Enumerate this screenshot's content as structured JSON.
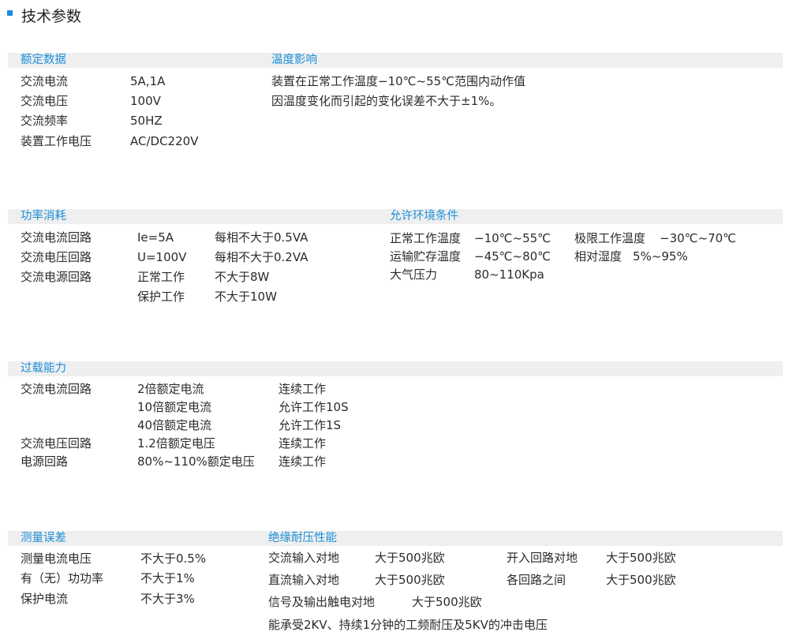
{
  "page_title": "技术参数",
  "rated": {
    "header": "额定数据",
    "rows": [
      {
        "label": "交流电流",
        "value": "5A,1A"
      },
      {
        "label": "交流电压",
        "value": "100V"
      },
      {
        "label": "交流频率",
        "value": "50HZ"
      },
      {
        "label": "装置工作电压",
        "value": "AC/DC220V"
      }
    ]
  },
  "temperature": {
    "header": "温度影响",
    "lines": [
      "装置在正常工作温度−10℃~55℃范围内动作值",
      "因温度变化而引起的变化误差不大于±1%。"
    ]
  },
  "power": {
    "header": "功率消耗",
    "rows": [
      {
        "label": "交流电流回路",
        "cond": "Ie=5A",
        "value": "每相不大于0.5VA"
      },
      {
        "label": "交流电压回路",
        "cond": "U=100V",
        "value": "每相不大于0.2VA"
      },
      {
        "label": "交流电源回路",
        "cond": "正常工作",
        "value": "不大于8W"
      },
      {
        "label": "",
        "cond": "保护工作",
        "value": "不大于10W"
      }
    ]
  },
  "environment": {
    "header": "允许环境条件",
    "items": [
      {
        "label": "正常工作温度",
        "value": "−10℃~55℃"
      },
      {
        "label": "极限工作温度",
        "value": "−30℃~70℃"
      },
      {
        "label": "运输贮存温度",
        "value": "−45℃~80℃"
      },
      {
        "label": "相对湿度",
        "value": "5%~95%"
      },
      {
        "label": "大气压力",
        "value": "80~110Kpa"
      }
    ]
  },
  "overload": {
    "header": "过载能力",
    "rows": [
      {
        "label": "交流电流回路",
        "cond": "2倍额定电流",
        "value": "连续工作"
      },
      {
        "label": "",
        "cond": "10倍额定电流",
        "value": "允许工作10S"
      },
      {
        "label": "",
        "cond": "40倍额定电流",
        "value": "允许工作1S"
      },
      {
        "label": "交流电压回路",
        "cond": "1.2倍额定电压",
        "value": "连续工作"
      },
      {
        "label": "电源回路",
        "cond": "80%~110%额定电压",
        "value": "连续工作"
      }
    ]
  },
  "measurement": {
    "header": "测量误差",
    "rows": [
      {
        "label": "测量电流电压",
        "value": "不大于0.5%"
      },
      {
        "label": "有（无）功功率",
        "value": "不大于1%"
      },
      {
        "label": "保护电流",
        "value": "不大于3%"
      }
    ]
  },
  "insulation": {
    "header": "绝缘耐压性能",
    "items": [
      {
        "label": "交流输入对地",
        "value": "大于500兆欧"
      },
      {
        "label": "开入回路对地",
        "value": "大于500兆欧"
      },
      {
        "label": "直流输入对地",
        "value": "大于500兆欧"
      },
      {
        "label": "各回路之间",
        "value": "大于500兆欧"
      },
      {
        "label": "信号及输出触电对地",
        "value": "大于500兆欧"
      }
    ],
    "note": "能承受2KV、持续1分钟的工频耐压及5KV的冲击电压"
  }
}
